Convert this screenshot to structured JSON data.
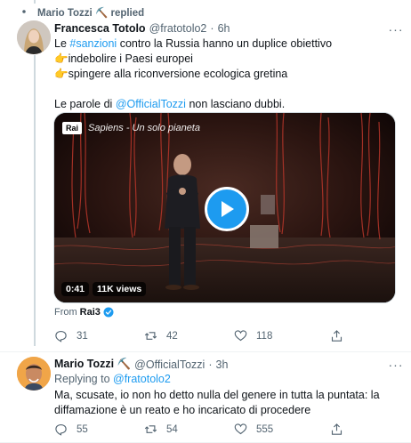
{
  "context": {
    "text": "Mario Tozzi ⛏️ replied"
  },
  "tweet1": {
    "name": "Francesca Totolo",
    "handle": "@fratotolo2",
    "dot": "·",
    "time": "6h",
    "line1_pre": "Le ",
    "line1_hashtag": "#sanzioni",
    "line1_post": " contro la Russia hanno un duplice obiettivo",
    "bullet_emoji": "👉",
    "bullet1": "indebolire i Paesi europei",
    "bullet2": "spingere alla riconversione ecologica gretina",
    "line4_pre": "Le parole di ",
    "line4_mention": "@OfficialTozzi",
    "line4_post": " non lasciano dubbi.",
    "video": {
      "channel_logo": "Rai",
      "program_title": "Sapiens - Un solo pianeta",
      "duration": "0:41",
      "views": "11K views"
    },
    "from_label": "From",
    "from_source": "Rai3",
    "stats": {
      "replies": "31",
      "retweets": "42",
      "likes": "118"
    }
  },
  "tweet2": {
    "name": "Mario Tozzi ⛏️",
    "handle": "@OfficialTozzi",
    "dot": "·",
    "time": "3h",
    "replying_label": "Replying to ",
    "replying_to": "@fratotolo2",
    "text_line1": "Ma, scusate, io non ho detto nulla del genere in tutta la puntata: la",
    "text_line2": "diffamazione è un reato e ho incaricato di procedere",
    "stats": {
      "replies": "55",
      "retweets": "54",
      "likes": "555"
    }
  },
  "colors": {
    "link": "#1d9bf0",
    "secondary": "#536471",
    "verified": "#1d9bf0"
  },
  "icons": [
    "retweet-context-icon",
    "more-icon",
    "play-icon",
    "verified-icon",
    "reply-icon",
    "retweet-icon",
    "like-icon",
    "share-icon"
  ]
}
